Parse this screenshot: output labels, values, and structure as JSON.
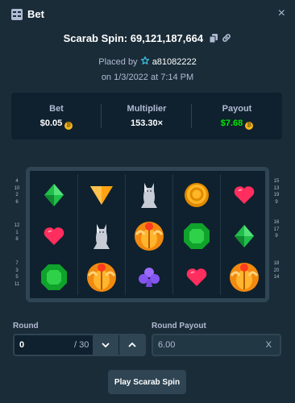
{
  "header": {
    "title": "Bet",
    "close_label": "×"
  },
  "spin": {
    "title": "Scarab Spin: 69,121,187,664"
  },
  "meta": {
    "placed_by_label": "Placed by",
    "username": "a81082222",
    "date": "on 1/3/2022 at 7:14 PM"
  },
  "stats": {
    "bet_label": "Bet",
    "bet_value": "$0.05",
    "multiplier_label": "Multiplier",
    "multiplier_value": "153.30×",
    "payout_label": "Payout",
    "payout_value": "$7.68"
  },
  "paylines": {
    "left": [
      [
        "4",
        "10",
        "2",
        "6"
      ],
      [
        "12",
        "1",
        "8"
      ],
      [
        "7",
        "3",
        "5",
        "11"
      ]
    ],
    "right": [
      [
        "15",
        "13",
        "19",
        "9"
      ],
      [
        "16",
        "17",
        "9"
      ],
      [
        "18",
        "20",
        "14"
      ]
    ]
  },
  "board": {
    "symbols": [
      [
        "green-diamond",
        "heart",
        "emerald"
      ],
      [
        "orange-triangle",
        "cat-statue",
        "scarab"
      ],
      [
        "cat-statue",
        "scarab",
        "purple-club"
      ],
      [
        "gold-coin",
        "emerald",
        "heart"
      ],
      [
        "heart",
        "green-diamond",
        "scarab"
      ]
    ]
  },
  "round": {
    "label": "Round",
    "value": "0",
    "total": "/ 30"
  },
  "round_payout": {
    "label": "Round Payout",
    "value": "6.00",
    "clear": "X"
  },
  "play_button": {
    "label": "Play Scarab Spin"
  },
  "colors": {
    "background": "#1a2c38",
    "panel": "#0f212e",
    "border": "#2f4553",
    "green": "#00e701",
    "muted": "#b1bad3"
  }
}
